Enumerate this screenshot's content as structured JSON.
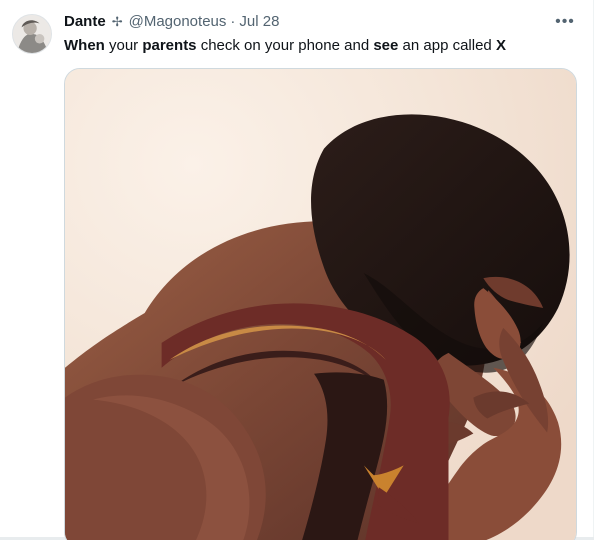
{
  "tweet": {
    "author_name": "Dante",
    "badge_icon": "sparkle-badge-icon",
    "handle": "@Magonoteus",
    "separator": "·",
    "date": "Jul 28",
    "more_icon": "more-horizontal-icon",
    "text_parts": [
      "When",
      " your ",
      "parents",
      " check on your phone and ",
      "see",
      " an app called ",
      "X"
    ],
    "media": {
      "icon": "image",
      "kind": "photo"
    }
  },
  "colors": {
    "text_primary": "#0f1419",
    "text_secondary": "#536471",
    "border": "#cfd9de",
    "image_background": "#f7ebe1"
  }
}
